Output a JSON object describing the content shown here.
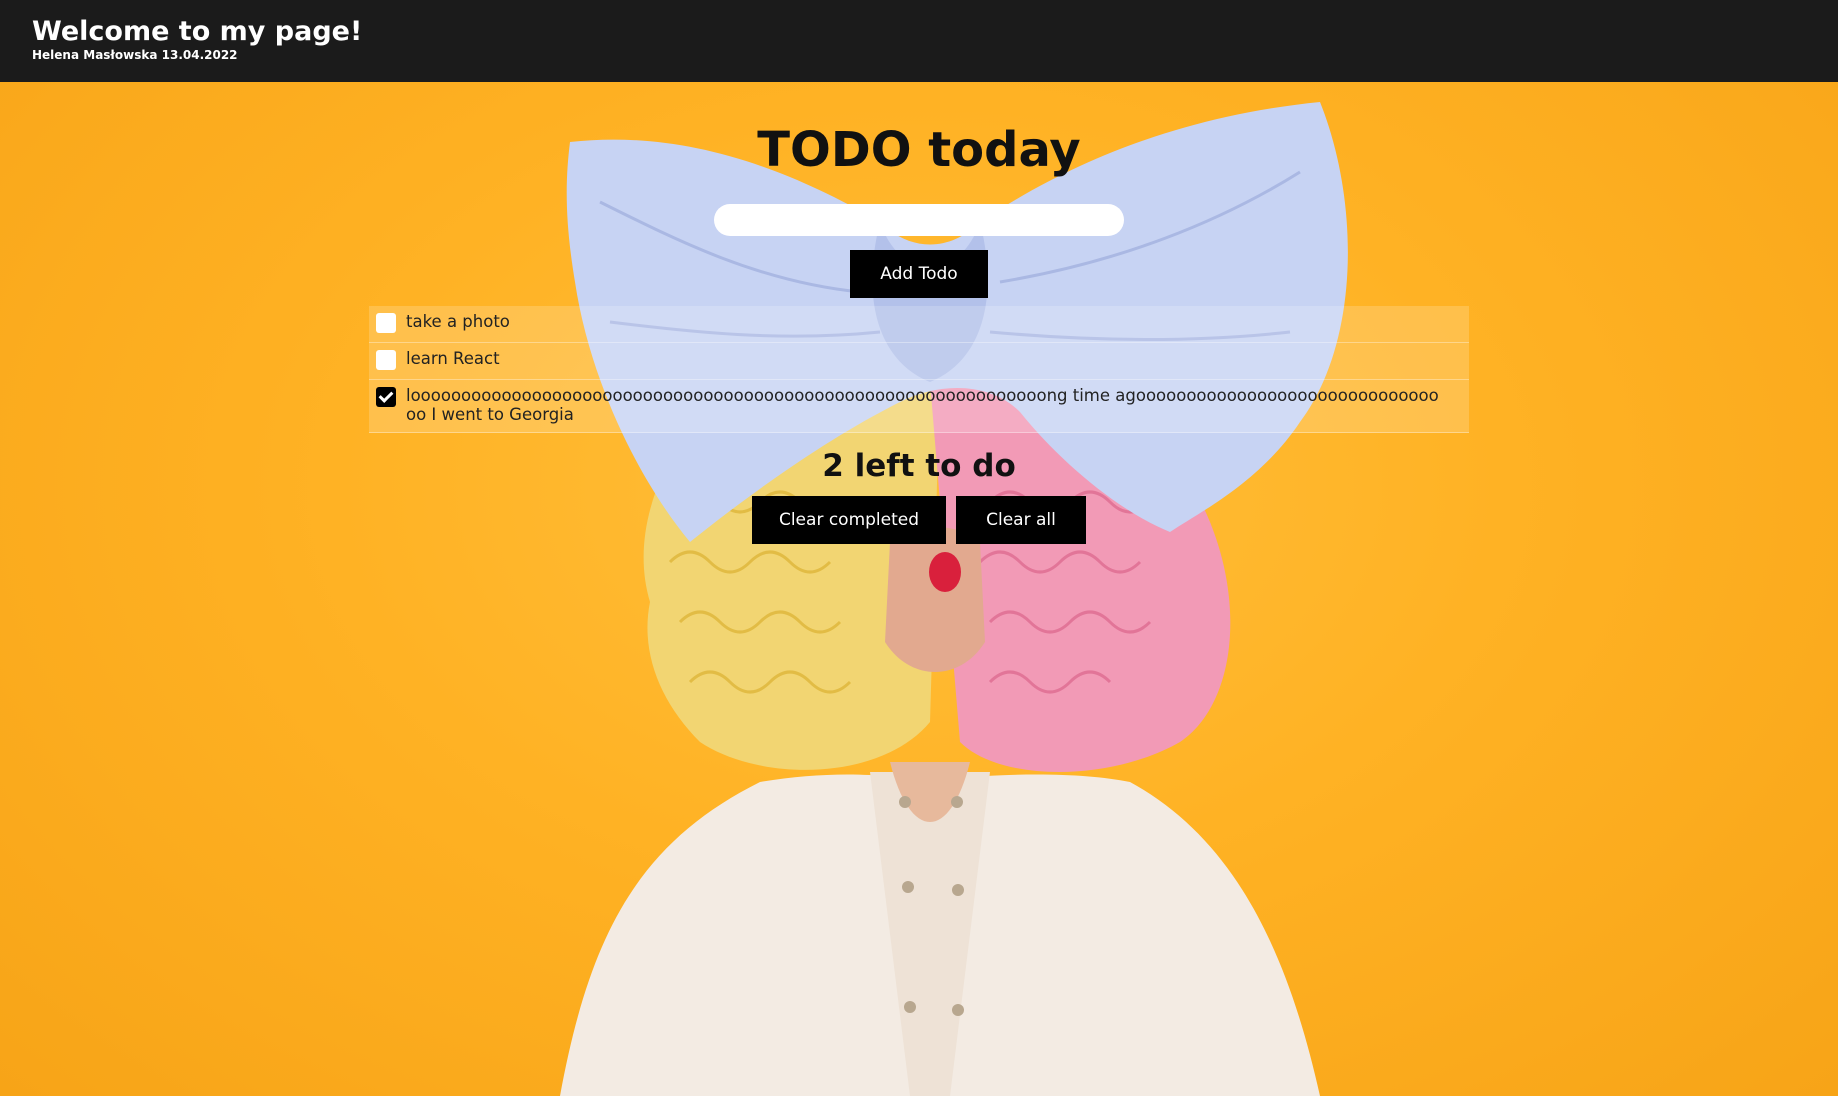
{
  "header": {
    "title": "Welcome to my page!",
    "byline": "Helena Masłowska 13.04.2022"
  },
  "todo": {
    "heading": "TODO today",
    "input_value": "",
    "add_label": "Add Todo",
    "items": [
      {
        "text": "take a photo",
        "done": false
      },
      {
        "text": "learn React",
        "done": false
      },
      {
        "text": "looooooooooooooooooooooooooooooooooooooooooooooooooooooooooooooong time agoooooooooooooooooooooooooooooooo I went to Georgia",
        "done": true
      }
    ],
    "counter": "2 left to do",
    "clear_completed_label": "Clear completed",
    "clear_all_label": "Clear all"
  },
  "colors": {
    "background": "#ffb224",
    "header": "#1b1b1b",
    "button": "#000000",
    "bow": "#c7d3f3"
  },
  "icons": {
    "checkbox_unchecked": "checkbox-unchecked-icon",
    "checkbox_checked": "checkbox-checked-icon"
  }
}
